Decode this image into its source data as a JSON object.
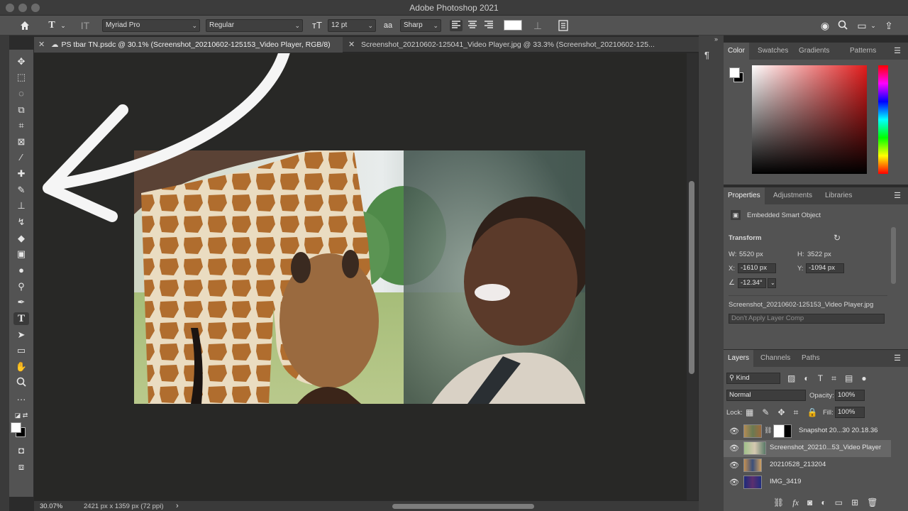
{
  "window": {
    "title": "Adobe Photoshop 2021"
  },
  "options_bar": {
    "font_family": "Myriad Pro",
    "font_style": "Regular",
    "font_size": "12 pt",
    "antialias_icon": "aa",
    "antialias": "Sharp"
  },
  "tabs": [
    {
      "label": "PS tbar TN.psdc @ 30.1% (Screenshot_20210602-125153_Video Player, RGB/8)",
      "active": true
    },
    {
      "label": "Screenshot_20210602-125041_Video Player.jpg @ 33.3% (Screenshot_20210602-125...",
      "active": false
    }
  ],
  "status_bar": {
    "zoom": "30.07%",
    "doc_info": "2421 px x 1359 px (72 ppi)",
    "arrow": "›"
  },
  "color_panel": {
    "tabs": [
      "Color",
      "Swatches",
      "Gradients",
      "Patterns"
    ],
    "active_tab": "Color"
  },
  "properties_panel": {
    "tabs": [
      "Properties",
      "Adjustments",
      "Libraries"
    ],
    "object_type": "Embedded Smart Object",
    "section": "Transform",
    "w_label": "W:",
    "w_value": "5520 px",
    "h_label": "H:",
    "h_value": "3522 px",
    "x_label": "X:",
    "x_value": "-1610 px",
    "y_label": "Y:",
    "y_value": "-1094 px",
    "angle": "-12.34°",
    "source_file": "Screenshot_20210602-125153_Video Player.jpg",
    "layer_comp": "Don't Apply Layer Comp"
  },
  "layers_panel": {
    "tabs": [
      "Layers",
      "Channels",
      "Paths"
    ],
    "filter": "Kind",
    "blend_mode": "Normal",
    "opacity_label": "Opacity:",
    "opacity": "100%",
    "lock_label": "Lock:",
    "fill_label": "Fill:",
    "fill": "100%",
    "layers": [
      {
        "name": "Snapshot 20...30 20.18.36",
        "selected": false
      },
      {
        "name": "Screenshot_20210...53_Video Player",
        "selected": true
      },
      {
        "name": "20210528_213204",
        "selected": false
      },
      {
        "name": "IMG_3419",
        "selected": false
      }
    ]
  },
  "icons": {
    "eye": "👁",
    "menu": "☰",
    "fx": "fx"
  },
  "colors": {
    "accent_red": "#e11b1b",
    "canvas_bg": "#282826",
    "panel_bg": "#535353"
  }
}
